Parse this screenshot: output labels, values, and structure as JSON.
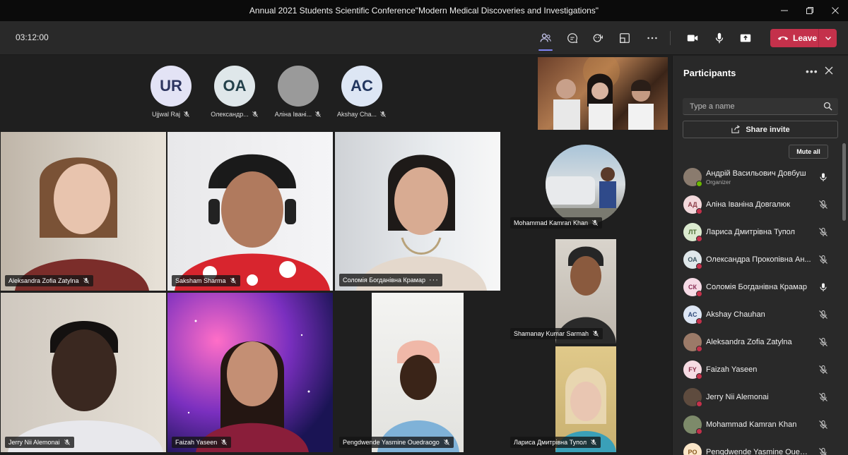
{
  "window": {
    "title": "Annual 2021 Students Scientific Conference\"Modern Medical Discoveries and Investigations\""
  },
  "toolbar": {
    "timer": "03:12:00",
    "leave_label": "Leave"
  },
  "avatar_strip": [
    {
      "initials": "UR",
      "name": "Ujjwal Raj",
      "color": "#e3e3f5"
    },
    {
      "initials": "OA",
      "name": "Олександр...",
      "color": "#dfe7ea"
    },
    {
      "initials": "",
      "name": "Аліна Івані...",
      "color": "#9a9a9a"
    },
    {
      "initials": "AC",
      "name": "Akshay Cha...",
      "color": "#dde6f4"
    }
  ],
  "tiles": [
    {
      "name": "Aleksandra Zofia Zatylna"
    },
    {
      "name": "Saksham Sharma"
    },
    {
      "name": "Соломія Богданівна Крамар",
      "more": "···"
    },
    {
      "name": "Jerry Nii Alemonai"
    },
    {
      "name": "Faizah Yaseen"
    },
    {
      "name": "Pengdwende Yasmine Ouedraogo"
    },
    {
      "name": "Mohammad Kamran Khan"
    },
    {
      "name": "Shamanay Kumar Sarmah"
    },
    {
      "name": "Лариса Дмитрівна Тупол"
    }
  ],
  "panel": {
    "title": "Participants",
    "search_placeholder": "Type a name",
    "share_invite": "Share invite",
    "mute_all": "Mute all",
    "participants": [
      {
        "name": "Андрій Васильович Довбуш",
        "role": "Organizer",
        "initials": "",
        "avatar_color": "#8a7b6e",
        "mic": "on"
      },
      {
        "name": "Аліна Іваніна Довгалюк",
        "initials": "АД",
        "avatar_color": "#f3d9dc",
        "text_color": "#8b3a45",
        "mic": "off"
      },
      {
        "name": "Лариса Дмитрівна Тупол",
        "initials": "ЛТ",
        "avatar_color": "#dbeacf",
        "text_color": "#4a6b2f",
        "mic": "off"
      },
      {
        "name": "Олександра Прокопівна Ан...",
        "initials": "ОА",
        "avatar_color": "#dfe7ea",
        "text_color": "#3b5560",
        "mic": "off"
      },
      {
        "name": "Соломія Богданівна Крамар",
        "initials": "СК",
        "avatar_color": "#f6dbe6",
        "text_color": "#8b2f56",
        "mic": "on"
      },
      {
        "name": "Akshay Chauhan",
        "initials": "AC",
        "avatar_color": "#dde6f4",
        "text_color": "#2f4a7a",
        "mic": "off"
      },
      {
        "name": "Aleksandra Zofia Zatylna",
        "initials": "",
        "avatar_color": "#9b7a68",
        "mic": "off"
      },
      {
        "name": "Faizah Yaseen",
        "initials": "FY",
        "avatar_color": "#f6dbe3",
        "text_color": "#8b2f4a",
        "mic": "off"
      },
      {
        "name": "Jerry Nii Alemonai",
        "initials": "",
        "avatar_color": "#5e4b3e",
        "mic": "off"
      },
      {
        "name": "Mohammad Kamran Khan",
        "initials": "",
        "avatar_color": "#7d8a6a",
        "mic": "off"
      },
      {
        "name": "Pengdwende Yasmine Ouedra...",
        "initials": "PO",
        "avatar_color": "#fbe6c8",
        "text_color": "#8a5a1f",
        "mic": "off"
      }
    ]
  },
  "colors": {
    "leave": "#c4314b",
    "accent": "#7f85f5",
    "status_green": "#6bb700",
    "status_red": "#c4314b"
  }
}
